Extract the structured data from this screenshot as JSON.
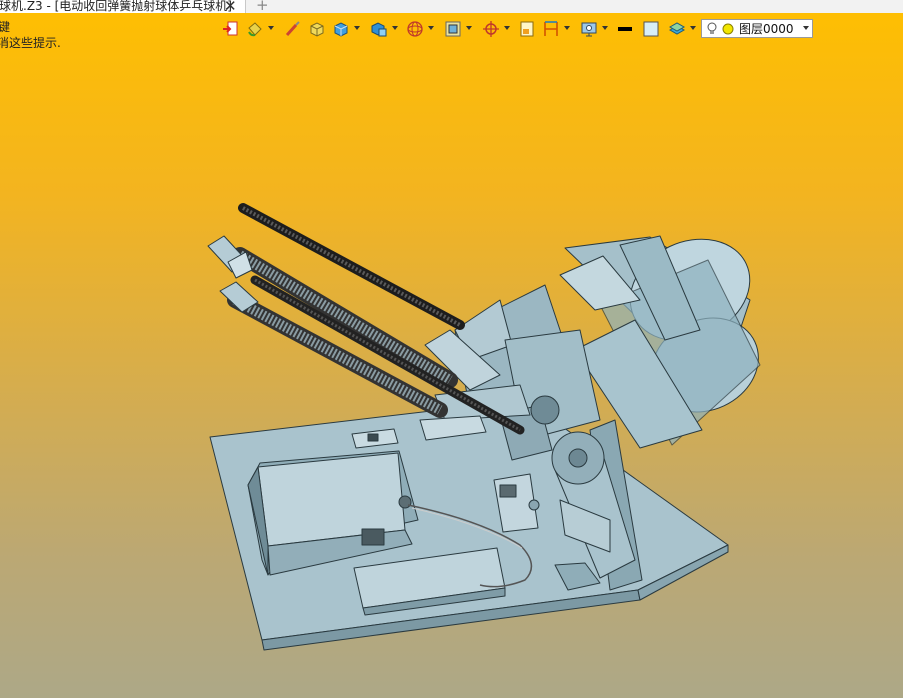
{
  "tab": {
    "title": "球机.Z3 - [电动收回弹簧抛射球体乒乓球机]",
    "close_symbol": "✕",
    "add_symbol": "+"
  },
  "command_label": "键",
  "hint_text": "消这些提示.",
  "toolbar": {
    "icons": [
      "exit-icon",
      "paint-bucket-icon",
      "brush-icon",
      "box-icon",
      "cube-shaded-icon",
      "cube-view-icon",
      "wireframe-sphere-icon",
      "display-frame-icon",
      "target-icon",
      "page-icon",
      "dimension-icon",
      "screen-capture-icon",
      "line-color-icon",
      "fill-color-icon",
      "layer-stack-icon"
    ],
    "line_color": "#000000",
    "fill_color": "#d8eef6"
  },
  "layer": {
    "name": "图层0000"
  },
  "colors": {
    "model_fill": "#a9c3cd",
    "model_edge": "#2a3a40",
    "background_top": "#ffbf00",
    "background_bottom": "#ada887"
  }
}
